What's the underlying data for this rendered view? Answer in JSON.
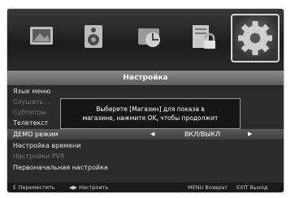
{
  "menu_icons": [
    {
      "name": "picture-icon"
    },
    {
      "name": "sound-icon"
    },
    {
      "name": "channel-icon"
    },
    {
      "name": "lock-icon"
    },
    {
      "name": "settings-icon",
      "selected": true
    }
  ],
  "title": "Настройка",
  "menu_items": [
    {
      "label": "Язык меню",
      "state": "normal"
    },
    {
      "label": "Слушать …",
      "state": "dim"
    },
    {
      "label": "Субтитры",
      "state": "dim"
    },
    {
      "label": "Телетекст",
      "state": "normal"
    },
    {
      "label": "ДЕМО режим",
      "state": "highlighted",
      "value": "ВКЛ/ВЫКЛ"
    },
    {
      "label": "Настройка времени",
      "state": "normal"
    },
    {
      "label": "Настройки PVR",
      "state": "dim"
    },
    {
      "label": "Первоначальная настройка",
      "state": "normal"
    }
  ],
  "popup": {
    "line1": "Выберете [Магазин] для показа в",
    "line2": "магазине, нажмите OK, чтобы продолжит"
  },
  "hints": [
    {
      "text": "↕ Переместить"
    },
    {
      "text": "◀▶ Настроить"
    },
    {
      "text": "MENU Возврат"
    },
    {
      "text": "EXIT Выход"
    }
  ]
}
